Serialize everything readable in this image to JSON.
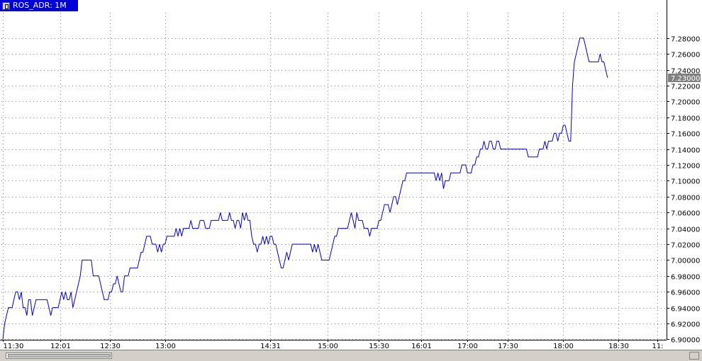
{
  "window": {
    "tab_label": "ROS_ADR: 1M"
  },
  "chart_data": {
    "type": "line",
    "title": "ROS_ADR: 1M",
    "xlabel": "",
    "ylabel": "",
    "ylim": [
      6.89,
      7.29
    ],
    "grid": true,
    "line_color": "#0000c8",
    "grid_color": "#808080",
    "price_label_color": "#808080",
    "y_ticks": [
      "6.90000",
      "6.92000",
      "6.94000",
      "6.96000",
      "6.98000",
      "7.00000",
      "7.02000",
      "7.04000",
      "7.06000",
      "7.08000",
      "7.10000",
      "7.12000",
      "7.14000",
      "7.16000",
      "7.18000",
      "7.20000",
      "7.22000",
      "7.24000",
      "7.26000",
      "7.28000"
    ],
    "y_tick_values": [
      6.9,
      6.92,
      6.94,
      6.96,
      6.98,
      7.0,
      7.02,
      7.04,
      7.06,
      7.08,
      7.1,
      7.12,
      7.14,
      7.16,
      7.18,
      7.2,
      7.22,
      7.24,
      7.26,
      7.28
    ],
    "x_ticks": [
      "11:30",
      "12:01",
      "12:30",
      "13:00",
      "14:31",
      "15:00",
      "15:30",
      "16:01",
      "17:00",
      "17:30",
      "18:00",
      "18:30",
      "11:"
    ],
    "x_tick_index": [
      0,
      31,
      58,
      88,
      145,
      176,
      204,
      227,
      252,
      274,
      304,
      334,
      355
    ],
    "current_price": "7.23000",
    "current_value": 7.23,
    "series": [
      {
        "values": [
          6.9,
          6.92,
          6.93,
          6.94,
          6.94,
          6.94,
          6.95,
          6.96,
          6.96,
          6.95,
          6.96,
          6.94,
          6.94,
          6.93,
          6.95,
          6.95,
          6.93,
          6.94,
          6.95,
          6.95,
          6.95,
          6.95,
          6.95,
          6.95,
          6.95,
          6.94,
          6.93,
          6.94,
          6.94,
          6.94,
          6.94,
          6.95,
          6.96,
          6.95,
          6.96,
          6.95,
          6.95,
          6.96,
          6.94,
          6.95,
          6.96,
          6.97,
          6.98,
          7.0,
          7.0,
          7.0,
          7.0,
          7.0,
          7.0,
          6.98,
          6.98,
          6.98,
          6.98,
          6.97,
          6.96,
          6.95,
          6.95,
          6.95,
          6.96,
          6.96,
          6.97,
          6.97,
          6.98,
          6.97,
          6.96,
          6.96,
          6.98,
          6.98,
          6.98,
          6.99,
          6.99,
          6.99,
          6.99,
          6.99,
          7.0,
          7.01,
          7.01,
          7.02,
          7.03,
          7.03,
          7.03,
          7.02,
          7.02,
          7.02,
          7.01,
          7.02,
          7.01,
          7.02,
          7.02,
          7.03,
          7.03,
          7.03,
          7.03,
          7.03,
          7.04,
          7.03,
          7.04,
          7.03,
          7.04,
          7.04,
          7.04,
          7.04,
          7.05,
          7.04,
          7.04,
          7.04,
          7.04,
          7.05,
          7.05,
          7.05,
          7.04,
          7.04,
          7.04,
          7.05,
          7.05,
          7.05,
          7.05,
          7.05,
          7.06,
          7.05,
          7.05,
          7.05,
          7.05,
          7.06,
          7.05,
          7.05,
          7.04,
          7.05,
          7.05,
          7.04,
          7.06,
          7.05,
          7.06,
          7.05,
          7.05,
          7.03,
          7.02,
          7.02,
          7.01,
          7.02,
          7.02,
          7.03,
          7.02,
          7.03,
          7.02,
          7.03,
          7.03,
          7.02,
          7.02,
          7.01,
          7.0,
          6.99,
          6.99,
          7.0,
          7.01,
          7.0,
          7.01,
          7.02,
          7.02,
          7.02,
          7.02,
          7.02,
          7.02,
          7.02,
          7.02,
          7.02,
          7.02,
          7.02,
          7.01,
          7.02,
          7.01,
          7.02,
          7.01,
          7.0,
          7.0,
          7.0,
          7.0,
          7.0,
          7.01,
          7.02,
          7.03,
          7.03,
          7.04,
          7.04,
          7.04,
          7.04,
          7.04,
          7.04,
          7.05,
          7.06,
          7.05,
          7.04,
          7.06,
          7.05,
          7.05,
          7.05,
          7.04,
          7.04,
          7.04,
          7.03,
          7.04,
          7.04,
          7.04,
          7.04,
          7.05,
          7.05,
          7.06,
          7.07,
          7.07,
          7.07,
          7.06,
          7.07,
          7.08,
          7.08,
          7.07,
          7.08,
          7.09,
          7.1,
          7.1,
          7.11,
          7.11,
          7.11,
          7.11,
          7.11,
          7.11,
          7.11,
          7.11,
          7.11,
          7.11,
          7.11,
          7.11,
          7.11,
          7.11,
          7.11,
          7.11,
          7.1,
          7.11,
          7.1,
          7.11,
          7.09,
          7.1,
          7.1,
          7.1,
          7.11,
          7.11,
          7.11,
          7.11,
          7.11,
          7.11,
          7.12,
          7.12,
          7.12,
          7.11,
          7.11,
          7.11,
          7.12,
          7.12,
          7.13,
          7.13,
          7.14,
          7.14,
          7.15,
          7.14,
          7.14,
          7.15,
          7.15,
          7.14,
          7.14,
          7.15,
          7.15,
          7.14,
          7.14,
          7.14,
          7.14,
          7.14,
          7.14,
          7.14,
          7.14,
          7.14,
          7.14,
          7.14,
          7.14,
          7.14,
          7.14,
          7.14,
          7.13,
          7.13,
          7.13,
          7.13,
          7.13,
          7.13,
          7.14,
          7.14,
          7.14,
          7.15,
          7.14,
          7.15,
          7.15,
          7.15,
          7.16,
          7.16,
          7.15,
          7.16,
          7.16,
          7.17,
          7.17,
          7.16,
          7.15,
          7.15,
          7.22,
          7.25,
          7.26,
          7.27,
          7.28,
          7.28,
          7.28,
          7.27,
          7.26,
          7.25,
          7.25,
          7.25,
          7.25,
          7.25,
          7.25,
          7.26,
          7.25,
          7.25,
          7.24,
          7.23
        ]
      }
    ]
  }
}
